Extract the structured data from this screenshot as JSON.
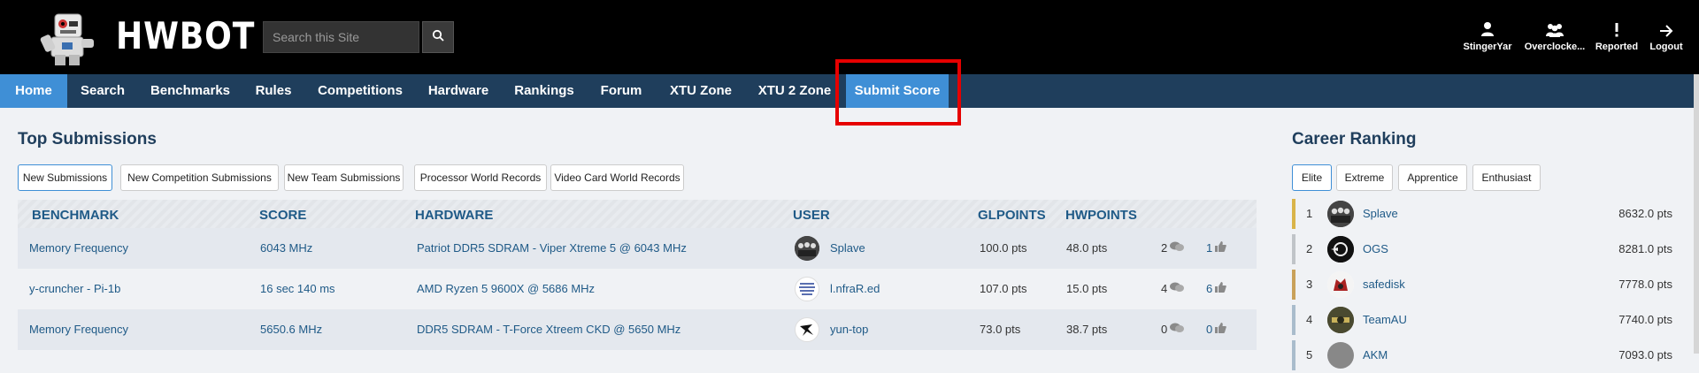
{
  "header": {
    "logo_text": "HWBOT",
    "search_placeholder": "Search this Site",
    "user_items": [
      {
        "label": "StingerYar",
        "icon": "user-icon"
      },
      {
        "label": "Overclocke...",
        "icon": "users-icon"
      },
      {
        "label": "Reported",
        "icon": "exclamation-icon"
      },
      {
        "label": "Logout",
        "icon": "logout-arrow-icon"
      }
    ]
  },
  "nav": {
    "items": [
      "Home",
      "Search",
      "Benchmarks",
      "Rules",
      "Competitions",
      "Hardware",
      "Rankings",
      "Forum",
      "XTU Zone",
      "XTU 2 Zone",
      "Submit Score"
    ],
    "active": "Home",
    "highlighted": "Submit Score"
  },
  "top_submissions": {
    "title": "Top Submissions",
    "tabs": [
      "New Submissions",
      "New Competition Submissions",
      "New Team Submissions",
      "Processor World Records",
      "Video Card World Records"
    ],
    "active_tab": "New Submissions",
    "columns": [
      "BENCHMARK",
      "SCORE",
      "HARDWARE",
      "USER",
      "GLPOINTS",
      "HWPOINTS"
    ],
    "rows": [
      {
        "benchmark": "Memory Frequency",
        "score": "6043 MHz",
        "hardware": "Patriot DDR5 SDRAM - Viper Xtreme 5 @ 6043 MHz",
        "user": "Splave",
        "glpoints": "100.0 pts",
        "hwpoints": "48.0 pts",
        "comments": "2",
        "likes": "1"
      },
      {
        "benchmark": "y-cruncher - Pi-1b",
        "score": "16 sec 140 ms",
        "hardware": "AMD Ryzen 5 9600X @ 5686 MHz",
        "user": "l.nfraR.ed",
        "glpoints": "107.0 pts",
        "hwpoints": "15.0 pts",
        "comments": "4",
        "likes": "6"
      },
      {
        "benchmark": "Memory Frequency",
        "score": "5650.6 MHz",
        "hardware": "DDR5 SDRAM - T-Force Xtreem CKD @ 5650 MHz",
        "user": "yun-top",
        "glpoints": "73.0 pts",
        "hwpoints": "38.7 pts",
        "comments": "0",
        "likes": "0"
      }
    ]
  },
  "career_ranking": {
    "title": "Career Ranking",
    "tabs": [
      "Elite",
      "Extreme",
      "Apprentice",
      "Enthusiast"
    ],
    "active_tab": "Elite",
    "rows": [
      {
        "rank": "1",
        "name": "Splave",
        "points": "8632.0 pts",
        "bar_color": "#d9b44a"
      },
      {
        "rank": "2",
        "name": "OGS",
        "points": "8281.0 pts",
        "bar_color": "#c0c4c8"
      },
      {
        "rank": "3",
        "name": "safedisk",
        "points": "7778.0 pts",
        "bar_color": "#c9a15a"
      },
      {
        "rank": "4",
        "name": "TeamAU",
        "points": "7740.0 pts",
        "bar_color": "#a9bccc"
      },
      {
        "rank": "5",
        "name": "AKM",
        "points": "7093.0 pts",
        "bar_color": "#a9bccc"
      }
    ]
  },
  "colors": {
    "header_bg": "#000000",
    "nav_bg": "#1f3e5c",
    "nav_active": "#3f8fd6",
    "highlight": "#e60000",
    "link": "#1f5a87"
  }
}
